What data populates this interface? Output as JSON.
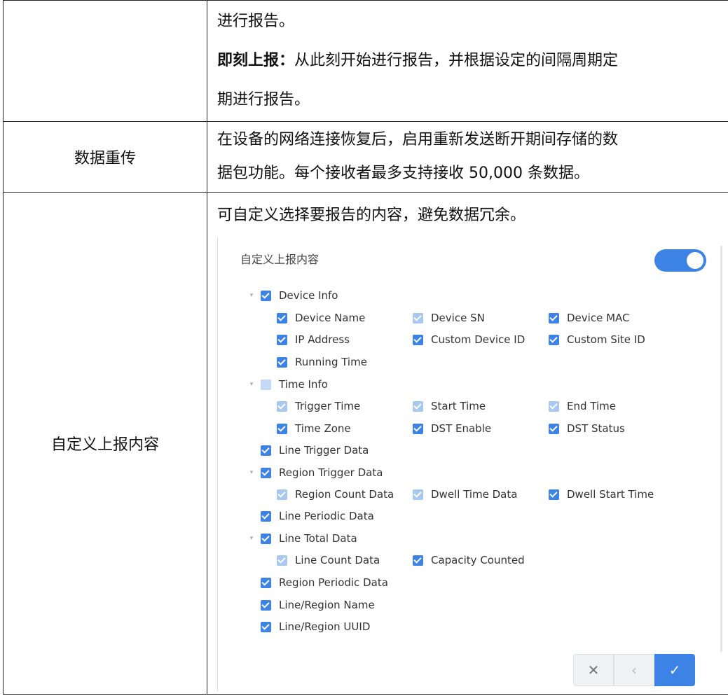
{
  "rows": {
    "report": {
      "label": "",
      "lines": [
        "进行报告。",
        "期进行报告。"
      ],
      "bold_prefix": "即刻上报：",
      "bold_rest": "从此刻开始进行报告，并根据设定的间隔周期定"
    },
    "retransmit": {
      "label": "数据重传",
      "lines": [
        "在设备的网络连接恢复后，启用重新发送断开期间存储的数",
        "据包功能。每个接收者最多支持接收 50,000 条数据。"
      ]
    },
    "custom": {
      "label": "自定义上报内容",
      "intro": "可自定义选择要报告的内容，避免数据冗余。"
    }
  },
  "panel": {
    "title": "自定义上报内容",
    "toggle_on": true,
    "accent": "#3d83e6",
    "tree": [
      {
        "label": "Device Info",
        "state": "on",
        "caret": true
      },
      {
        "label": "Device Name",
        "state": "on"
      },
      {
        "label": "Device SN",
        "state": "dim"
      },
      {
        "label": "Device MAC",
        "state": "on"
      },
      {
        "label": "IP Address",
        "state": "on"
      },
      {
        "label": "Custom Device ID",
        "state": "on"
      },
      {
        "label": "Custom Site ID",
        "state": "on"
      },
      {
        "label": "Running Time",
        "state": "on"
      },
      {
        "label": "Time Info",
        "state": "half",
        "caret": true
      },
      {
        "label": "Trigger Time",
        "state": "dim"
      },
      {
        "label": "Start Time",
        "state": "dim"
      },
      {
        "label": "End Time",
        "state": "dim"
      },
      {
        "label": "Time Zone",
        "state": "on"
      },
      {
        "label": "DST Enable",
        "state": "on"
      },
      {
        "label": "DST Status",
        "state": "on"
      },
      {
        "label": "Line Trigger Data",
        "state": "on"
      },
      {
        "label": "Region Trigger Data",
        "state": "on",
        "caret": true
      },
      {
        "label": "Region Count Data",
        "state": "dim"
      },
      {
        "label": "Dwell Time Data",
        "state": "dim"
      },
      {
        "label": "Dwell Start Time",
        "state": "on"
      },
      {
        "label": "Line Periodic Data",
        "state": "on"
      },
      {
        "label": "Line Total Data",
        "state": "on",
        "caret": true
      },
      {
        "label": "Line Count Data",
        "state": "dim"
      },
      {
        "label": "Capacity Counted",
        "state": "on"
      },
      {
        "label": "Region Periodic Data",
        "state": "on"
      },
      {
        "label": "Line/Region Name",
        "state": "on"
      },
      {
        "label": "Line/Region UUID",
        "state": "on"
      }
    ],
    "buttons": {
      "close": "✕",
      "prev": "‹",
      "ok": "✓"
    }
  }
}
